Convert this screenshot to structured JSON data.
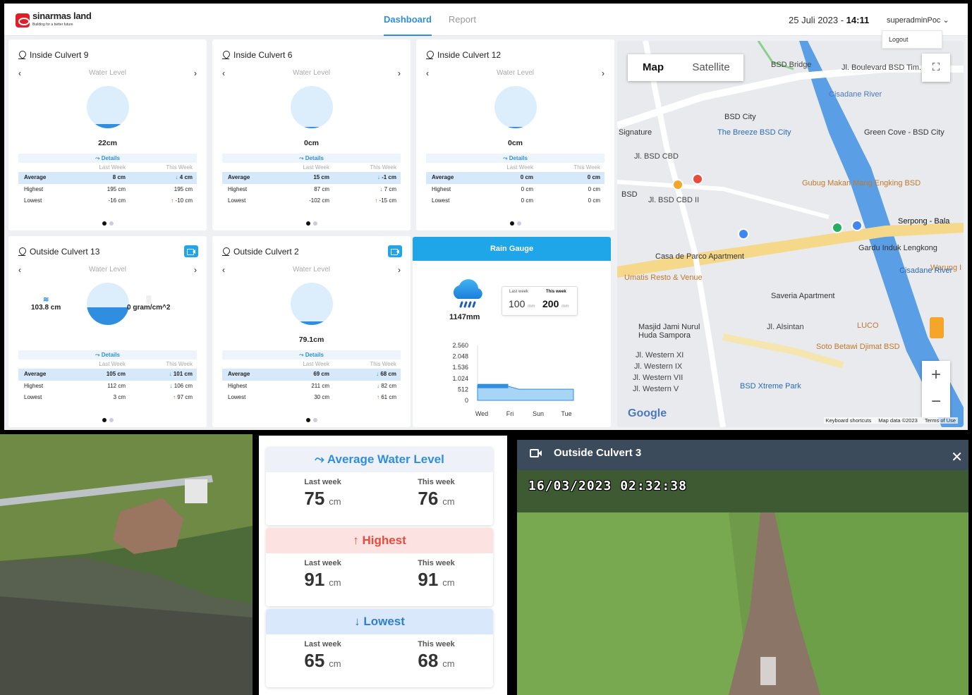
{
  "header": {
    "brand": "sinarmas land",
    "tagline": "Building for a better future",
    "tabs": [
      "Dashboard",
      "Report"
    ],
    "date": "25 Juli 2023 - ",
    "time": "14:11",
    "user": "superadminPoc",
    "logout": "Logout"
  },
  "common": {
    "water_level": "Water Level",
    "details": "Details",
    "last_week": "Last Week",
    "this_week": "This Week",
    "average": "Average",
    "highest": "Highest",
    "lowest": "Lowest"
  },
  "cards": [
    {
      "title": "Inside Culvert 9",
      "value": "22cm",
      "level": 0.1,
      "avg": [
        "8 cm",
        "4 cm"
      ],
      "high": [
        "195 cm",
        "195 cm"
      ],
      "low": [
        "-16 cm",
        "-10 cm"
      ],
      "dirs": [
        "down",
        "",
        "up"
      ]
    },
    {
      "title": "Inside Culvert 6",
      "value": "0cm",
      "level": 0.0,
      "avg": [
        "15 cm",
        "-1 cm"
      ],
      "high": [
        "87 cm",
        "7 cm"
      ],
      "low": [
        "-102 cm",
        "-15 cm"
      ],
      "dirs": [
        "down",
        "down",
        "up"
      ]
    },
    {
      "title": "Inside Culvert 12",
      "value": "0cm",
      "level": 0.0,
      "avg": [
        "0 cm",
        "0 cm"
      ],
      "high": [
        "0 cm",
        "0 cm"
      ],
      "low": [
        "0 cm",
        "0 cm"
      ],
      "dirs": [
        "",
        "",
        ""
      ]
    },
    {
      "title": "Outside Culvert 13",
      "value": "",
      "level": 0.42,
      "avg": [
        "105 cm",
        "101 cm"
      ],
      "high": [
        "112 cm",
        "106 cm"
      ],
      "low": [
        "3 cm",
        "97 cm"
      ],
      "dirs": [
        "down",
        "down",
        "up"
      ],
      "left_val": "103.8 cm",
      "right_val": "0 gram/cm^2"
    },
    {
      "title": "Outside Culvert 2",
      "value": "79.1cm",
      "level": 0.08,
      "avg": [
        "69 cm",
        "68 cm"
      ],
      "high": [
        "211 cm",
        "82 cm"
      ],
      "low": [
        "30 cm",
        "61 cm"
      ],
      "dirs": [
        "down",
        "down",
        "up"
      ]
    }
  ],
  "rain": {
    "title": "Rain Gauge",
    "total": "1147mm",
    "last_week_label": "Last week",
    "this_week_label": "This week",
    "last_week": "100",
    "this_week": "200",
    "unit": "mm"
  },
  "chart_data": {
    "type": "area",
    "x": [
      "Wed",
      "Fri",
      "Sun",
      "Tue"
    ],
    "yticks": [
      "2.560",
      "2.048",
      "1.536",
      "1.024",
      "512",
      "0"
    ],
    "ylim": [
      0,
      2560
    ],
    "series": [
      {
        "values": [
          700,
          700,
          700,
          520,
          520,
          520,
          520,
          520
        ]
      }
    ]
  },
  "map": {
    "tabs": [
      "Map",
      "Satellite"
    ],
    "labels": [
      "BSD Bridge",
      "Jl. Boulevard BSD Tim.",
      "Cisadane River",
      "BSD City",
      "The Breeze BSD City",
      "Green Cove - BSD City",
      "Signature",
      "Jl. BSD CBD",
      "Gubug Makan Mang Engking BSD",
      "BSD",
      "Jl. BSD CBD II",
      "Serpong - Bala",
      "Gardu Induk Lengkong",
      "Casa de Parco Apartment",
      "Umatis Resto & Venue",
      "Warung I Saur",
      "Saveria Apartment",
      "Cisadane River",
      "LUCO",
      "Masjid Jami Nurul Huda Sampora",
      "Jl. Alsintan",
      "Soto Betawi Djimat BSD",
      "Jl. Western XI",
      "Jl. Western IX",
      "Jl. Western VII",
      "Jl. Western V",
      "BSD Xtreme Park"
    ],
    "footer": [
      "Keyboard shortcuts",
      "Map data ©2023",
      "Terms of Use"
    ],
    "google": "Google"
  },
  "summary": {
    "avg_title": "Average Water Level",
    "high_title": "Highest",
    "low_title": "Lowest",
    "last": "Last week",
    "this": "This week",
    "avg": [
      "75",
      "76"
    ],
    "high": [
      "91",
      "91"
    ],
    "low": [
      "65",
      "68"
    ],
    "unit": "cm"
  },
  "video": {
    "title": "Outside Culvert 3",
    "timestamp": "16/03/2023  02:32:38"
  }
}
